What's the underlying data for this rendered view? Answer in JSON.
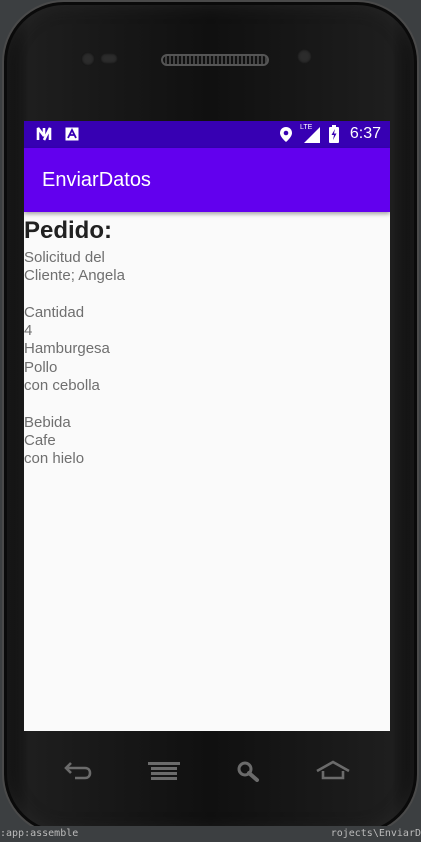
{
  "status_bar": {
    "time": "6:37",
    "network_label": "LTE"
  },
  "app_bar": {
    "title": "EnviarDatos"
  },
  "content": {
    "heading": "Pedido:",
    "lines": [
      "Solicitud del",
      "Cliente; Angela",
      "",
      "Cantidad",
      "4",
      "Hamburgesa",
      "Pollo",
      "con cebolla",
      "",
      "Bebida",
      "Cafe",
      "con hielo"
    ]
  },
  "ide": {
    "left_text": ":app:assemble",
    "right_text": "rojects\\EnviarD"
  },
  "colors": {
    "status_bar": "#3700b3",
    "app_bar": "#6200ee",
    "background": "#fafafa"
  },
  "nav_buttons": [
    "back-icon",
    "menu-icon",
    "search-icon",
    "home-icon"
  ]
}
